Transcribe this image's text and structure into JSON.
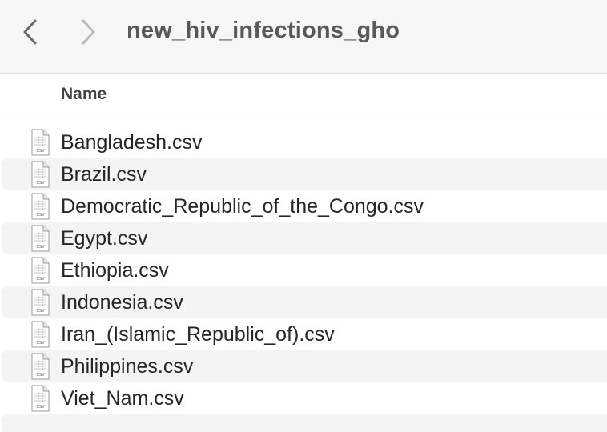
{
  "window": {
    "title": "new_hiv_infections_gho",
    "back_icon": "chevron-left-icon",
    "forward_icon": "chevron-right-icon"
  },
  "columns": {
    "name": "Name"
  },
  "files": [
    {
      "name": "Bangladesh.csv",
      "icon": "csv-file-icon",
      "icon_label": "CSV"
    },
    {
      "name": "Brazil.csv",
      "icon": "csv-file-icon",
      "icon_label": "CSV"
    },
    {
      "name": "Democratic_Republic_of_the_Congo.csv",
      "icon": "csv-file-icon",
      "icon_label": "CSV"
    },
    {
      "name": "Egypt.csv",
      "icon": "csv-file-icon",
      "icon_label": "CSV"
    },
    {
      "name": "Ethiopia.csv",
      "icon": "csv-file-icon",
      "icon_label": "CSV"
    },
    {
      "name": "Indonesia.csv",
      "icon": "csv-file-icon",
      "icon_label": "CSV"
    },
    {
      "name": "Iran_(Islamic_Republic_of).csv",
      "icon": "csv-file-icon",
      "icon_label": "CSV"
    },
    {
      "name": "Philippines.csv",
      "icon": "csv-file-icon",
      "icon_label": "CSV"
    },
    {
      "name": "Viet_Nam.csv",
      "icon": "csv-file-icon",
      "icon_label": "CSV"
    }
  ],
  "colors": {
    "toolbar_bg": "#f6f6f6",
    "row_alt_bg": "#f4f4f4",
    "title_text": "#595959",
    "file_text": "#262626"
  }
}
